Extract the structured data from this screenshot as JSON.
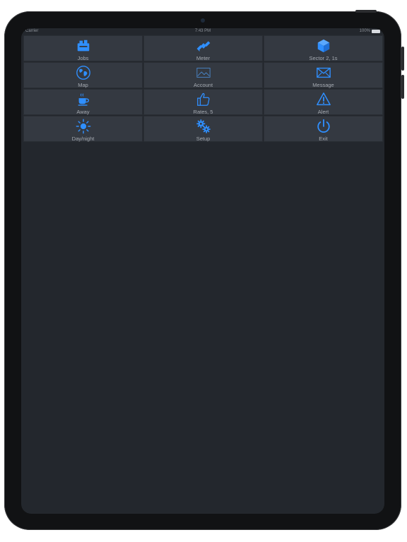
{
  "status_bar": {
    "carrier": "Carrier",
    "time": "7:43 PM",
    "battery": "100%"
  },
  "colors": {
    "accent": "#2f8fff",
    "tile": "#343941",
    "background": "#23272d"
  },
  "tiles": [
    {
      "label": "Jobs",
      "icon": "jobs-icon"
    },
    {
      "label": "Meter",
      "icon": "satellite-icon"
    },
    {
      "label": "Sector 2, 1s",
      "icon": "cube-icon"
    },
    {
      "label": "Map",
      "icon": "globe-icon"
    },
    {
      "label": "Account",
      "icon": "image-icon"
    },
    {
      "label": "Message",
      "icon": "envelope-icon"
    },
    {
      "label": "Away",
      "icon": "coffee-cup-icon"
    },
    {
      "label": "Rates, 5",
      "icon": "thumbs-up-icon"
    },
    {
      "label": "Alert",
      "icon": "warning-icon"
    },
    {
      "label": "Day/night",
      "icon": "sun-icon"
    },
    {
      "label": "Setup",
      "icon": "gears-icon"
    },
    {
      "label": "Exit",
      "icon": "power-icon"
    }
  ]
}
